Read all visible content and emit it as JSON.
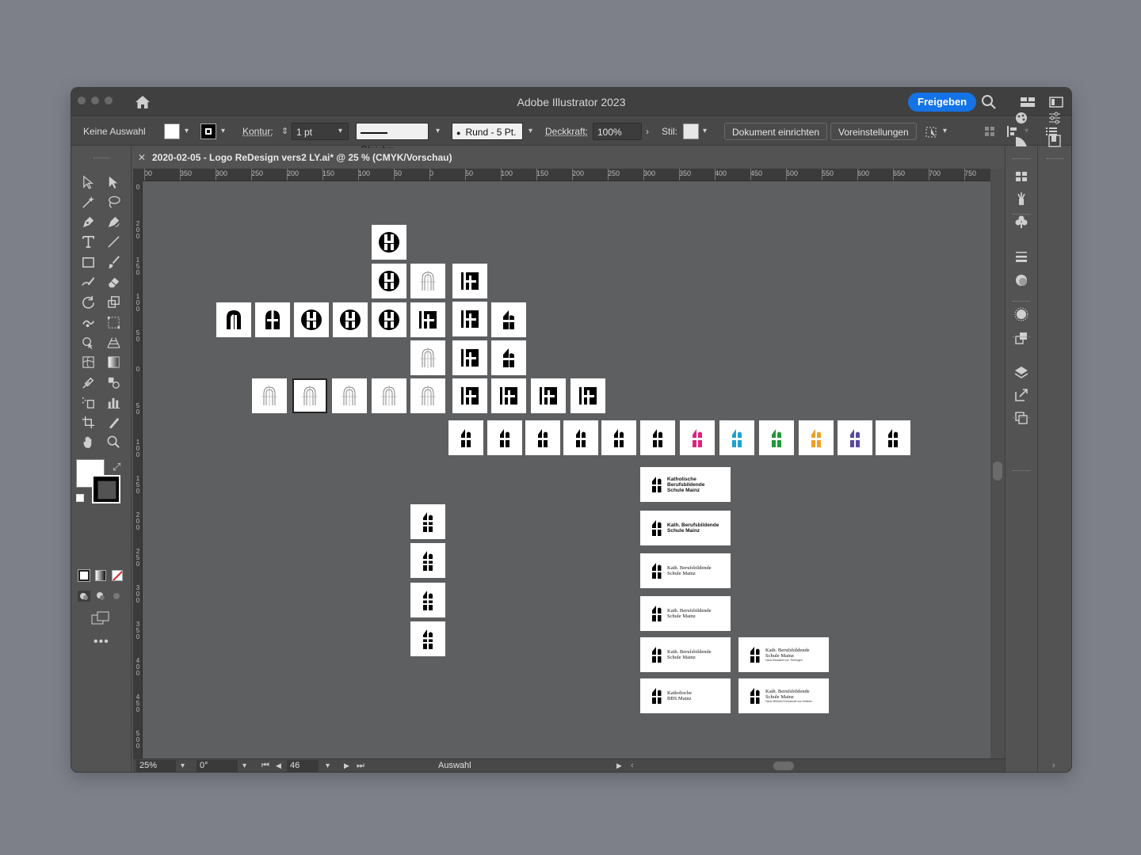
{
  "app": {
    "title": "Adobe Illustrator 2023",
    "share_label": "Freigeben"
  },
  "control_bar": {
    "selection": "Keine Auswahl",
    "stroke_label": "Kontur:",
    "stroke_weight": "1 pt",
    "stroke_profile": "Gleichm.",
    "brush": "Rund - 5 Pt.",
    "opacity_label": "Deckkraft:",
    "opacity_value": "100%",
    "style_label": "Stil:",
    "doc_setup_button": "Dokument einrichten",
    "preferences_button": "Voreinstellungen"
  },
  "document": {
    "tab_title": "2020-02-05 - Logo ReDesign vers2 LY.ai* @ 25 % (CMYK/Vorschau)"
  },
  "rulers": {
    "top_labels": [
      "00",
      "350",
      "300",
      "250",
      "200",
      "150",
      "100",
      "50",
      "0",
      "50",
      "100",
      "150",
      "200",
      "250",
      "300",
      "350",
      "400",
      "450",
      "500",
      "550",
      "600",
      "650",
      "700",
      "750"
    ],
    "left_labels": [
      "0",
      "200",
      "150",
      "100",
      "50",
      "0",
      "50",
      "100",
      "150",
      "200",
      "250",
      "300",
      "350",
      "400",
      "450",
      "500"
    ]
  },
  "status_bar": {
    "zoom": "25%",
    "rotation": "0°",
    "artboard_number": "46",
    "tool_status": "Auswahl"
  },
  "colors": {
    "magenta": "#e5207e",
    "cyan": "#1aa3d6",
    "green": "#1f9a3a",
    "orange": "#f0a020",
    "purple": "#5a4a9e",
    "accent": "#1473e6"
  },
  "wordmarks": [
    {
      "line1": "Katholische",
      "line2": "Berufsbildende",
      "line3": "Schule Mainz",
      "sub": ""
    },
    {
      "line1": "Kath. Berufsbildende",
      "line2": "Schule Mainz",
      "line3": "",
      "sub": ""
    },
    {
      "line1": "Kath. Berufsbildende",
      "line2": "Schule Mainz",
      "line3": "",
      "sub": ""
    },
    {
      "line1": "Kath. Berufsbildende",
      "line2": "Schule Mainz",
      "line3": "",
      "sub": ""
    },
    {
      "line1": "Kath. Berufsbildende",
      "line2": "Schule Mainz",
      "line3": "",
      "sub": ""
    },
    {
      "line1": "Katholische",
      "line2": "BBS Mainz",
      "line3": "",
      "sub": ""
    },
    {
      "line1": "Kath. Berufsbildende",
      "line2": "Schule Mainz",
      "line3": "",
      "sub": "Haus Elisabeth von Thüringen"
    },
    {
      "line1": "Kath. Berufsbildende",
      "line2": "Schule Mainz",
      "line3": "",
      "sub": "Haus Wilhelm Emmanuel von Ketteler"
    }
  ]
}
